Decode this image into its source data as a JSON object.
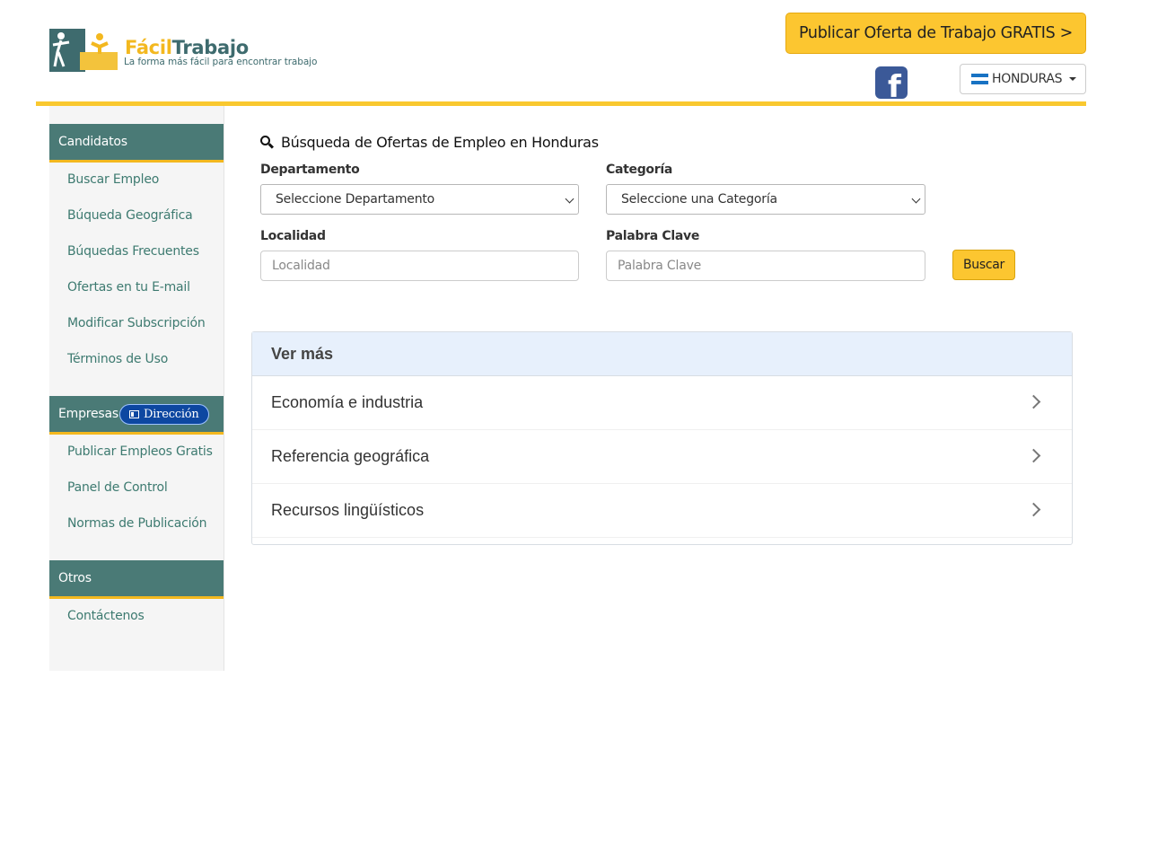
{
  "header": {
    "logo_brand_part1": "Fácil",
    "logo_brand_part2": "Trabajo",
    "logo_tagline": "La forma más fácil para encontrar trabajo",
    "cta_label": "Publicar Oferta de Trabajo GRATIS >",
    "social_icon": "facebook-icon",
    "country_label": "HONDURAS",
    "accent_color": "#f9c82f"
  },
  "sidebar": {
    "sections": [
      {
        "title": "Candidatos",
        "items": [
          "Buscar Empleo",
          "Búqueda Geográfica",
          "Búquedas Frecuentes",
          "Ofertas en tu E-mail",
          "Modificar Subscripción",
          "Términos de Uso"
        ]
      },
      {
        "title": "Empresas",
        "badge": "Dirección",
        "items": [
          "Publicar Empleos Gratis",
          "Panel de Control",
          "Normas de Publicación"
        ]
      },
      {
        "title": "Otros",
        "items": [
          "Contáctenos"
        ]
      }
    ],
    "head_color": "#4a7a76"
  },
  "search": {
    "title": "Búsqueda de Ofertas de Empleo en Honduras",
    "departamento_label": "Departamento",
    "departamento_value": "Seleccione Departamento",
    "categoria_label": "Categoría",
    "categoria_value": "Seleccione una Categoría",
    "localidad_label": "Localidad",
    "localidad_placeholder": "Localidad",
    "palabra_label": "Palabra Clave",
    "palabra_placeholder": "Palabra Clave",
    "button_label": "Buscar"
  },
  "ver_mas": {
    "title": "Ver más",
    "items": [
      "Economía e industria",
      "Referencia geográfica",
      "Recursos lingüísticos"
    ]
  }
}
